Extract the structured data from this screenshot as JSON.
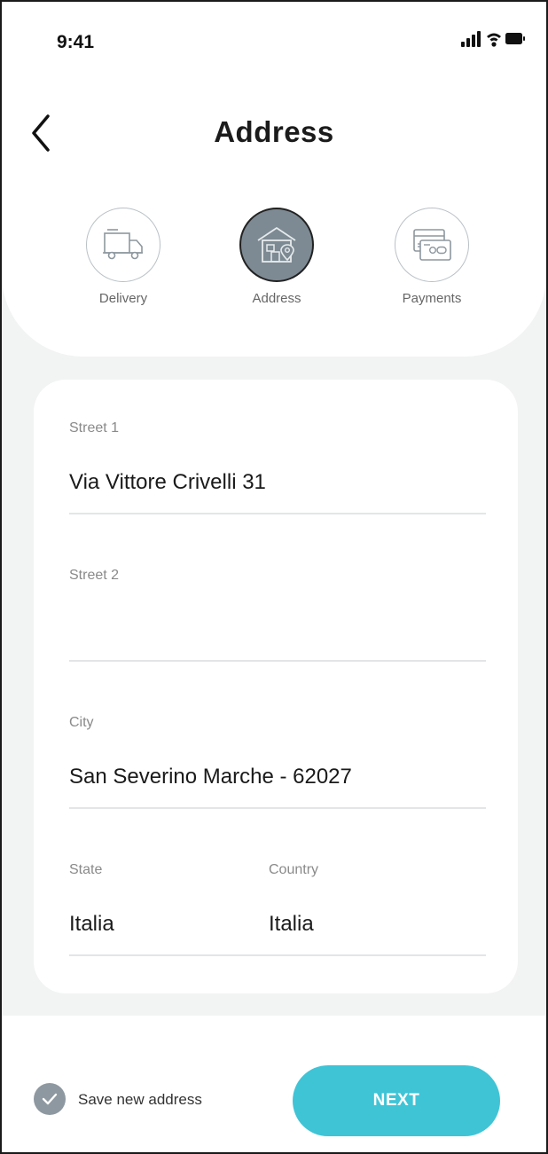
{
  "status_bar": {
    "time": "9:41"
  },
  "header": {
    "title": "Address"
  },
  "steps": [
    {
      "label": "Delivery",
      "icon": "truck-icon",
      "active": false
    },
    {
      "label": "Address",
      "icon": "house-location-icon",
      "active": true
    },
    {
      "label": "Payments",
      "icon": "credit-cards-icon",
      "active": false
    }
  ],
  "form": {
    "street1": {
      "label": "Street 1",
      "value": "Via Vittore Crivelli 31"
    },
    "street2": {
      "label": "Street 2",
      "value": ""
    },
    "city": {
      "label": "City",
      "value": "San Severino Marche - 62027"
    },
    "state": {
      "label": "State",
      "value": "Italia"
    },
    "country": {
      "label": "Country",
      "value": "Italia"
    }
  },
  "footer": {
    "save_label": "Save new address",
    "save_checked": true,
    "next_label": "NEXT"
  },
  "colors": {
    "accent": "#3fc4d6",
    "active_step": "#7d8a93",
    "background": "#f2f3f3",
    "check": "#8e98a0"
  }
}
